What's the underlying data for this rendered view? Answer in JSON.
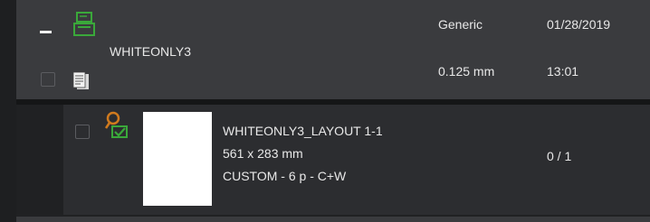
{
  "job": {
    "name": "WHITEONLY3",
    "media": "Generic",
    "thickness": "0.125 mm",
    "date": "01/28/2019",
    "time": "13:01"
  },
  "layout": {
    "name": "WHITEONLY3_LAYOUT 1-1",
    "size": "561 x 283 mm",
    "mode": "CUSTOM - 6 p - C+W",
    "copies": "0 / 1"
  },
  "colors": {
    "accent_green": "#3aa83a",
    "key_orange": "#d07a1e"
  },
  "icons": {
    "collapse": "minus-icon",
    "job_status": "green-printer-icon",
    "job_type": "document-stack-icon",
    "layout_status": "orange-key-check-icon"
  }
}
